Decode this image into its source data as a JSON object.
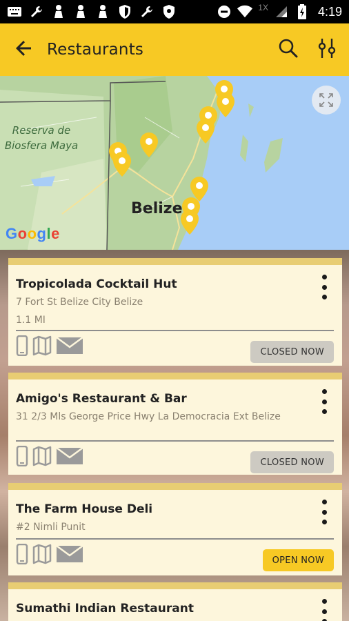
{
  "status_bar": {
    "time": "4:19",
    "network_label": "1X"
  },
  "app_bar": {
    "title": "Restaurants"
  },
  "map": {
    "reserve_label_line1": "Reserva de",
    "reserve_label_line2": "Biosfera Maya",
    "city_label": "Belize",
    "attribution": "Google"
  },
  "restaurants": [
    {
      "name": "Tropicolada Cocktail Hut",
      "address": "7 Fort St Belize City Belize",
      "distance": "1.1 MI",
      "status": "CLOSED NOW"
    },
    {
      "name": "Amigo's Restaurant & Bar",
      "address": "31 2/3 Mls George Price Hwy La Democracia Ext Belize",
      "distance": "",
      "status": "CLOSED NOW"
    },
    {
      "name": "The Farm House Deli",
      "address": "#2 Nimli Punit",
      "distance": "",
      "status": "OPEN NOW"
    },
    {
      "name": "Sumathi Indian Restaurant",
      "address": "",
      "distance": "",
      "status": ""
    }
  ],
  "colors": {
    "accent": "#f7c924",
    "card_bg": "#fdf6dc",
    "card_top": "#e8cd73",
    "water": "#a8cdf7",
    "land": "#b9d7a6"
  }
}
